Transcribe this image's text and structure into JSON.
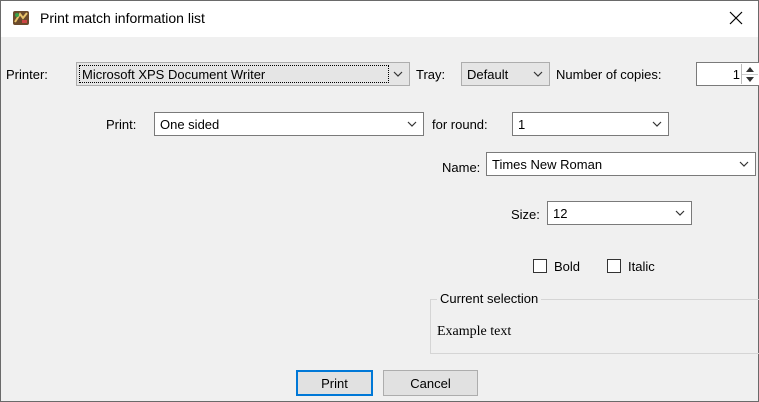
{
  "window": {
    "title": "Print match information list",
    "app_icon": "tournament-app-icon",
    "close_icon": "close-icon"
  },
  "printer": {
    "label": "Printer:",
    "value": "Microsoft XPS Document Writer"
  },
  "tray": {
    "label": "Tray:",
    "value": "Default"
  },
  "copies": {
    "label": "Number of copies:",
    "value": "1"
  },
  "print_mode": {
    "label": "Print:",
    "value": "One sided"
  },
  "round": {
    "label": "for round:",
    "value": "1"
  },
  "font_name": {
    "label": "Name:",
    "value": "Times New Roman"
  },
  "font_size": {
    "label": "Size:",
    "value": "12"
  },
  "bold": {
    "label": "Bold",
    "checked": false
  },
  "italic": {
    "label": "Italic",
    "checked": false
  },
  "current_selection": {
    "title": "Current selection",
    "example": "Example text"
  },
  "buttons": {
    "print": "Print",
    "cancel": "Cancel"
  },
  "colors": {
    "dialog_bg": "#f0f0f0",
    "default_button_border": "#0078d7"
  }
}
